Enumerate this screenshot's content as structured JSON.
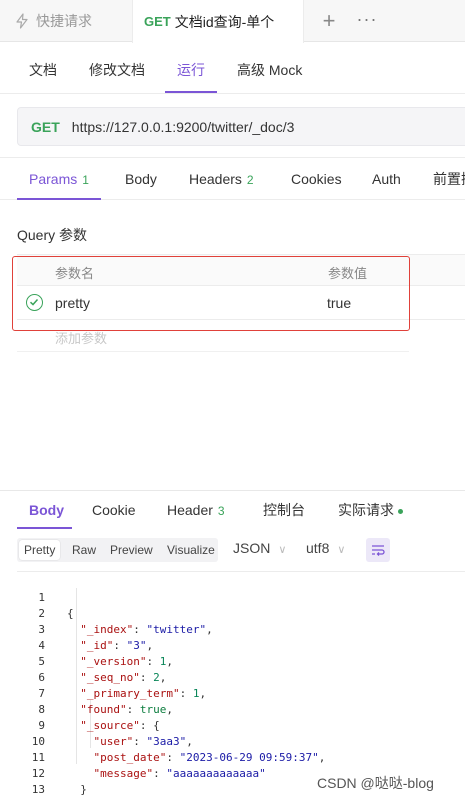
{
  "tabs": {
    "tab1_label": "快捷请求",
    "tab2_method": "GET",
    "tab2_label": "文档id查询-单个",
    "plus": "+",
    "more": "···"
  },
  "subnav": {
    "items": [
      "文档",
      "修改文档",
      "运行",
      "高级 Mock"
    ],
    "active": "运行"
  },
  "request": {
    "method": "GET",
    "url": "https://127.0.0.1:9200/twitter/_doc/3"
  },
  "req_tabs": {
    "params": "Params",
    "params_count": "1",
    "body": "Body",
    "headers": "Headers",
    "headers_count": "2",
    "cookies": "Cookies",
    "auth": "Auth",
    "more": "前置操"
  },
  "query": {
    "title": "Query 参数",
    "col_name": "参数名",
    "col_value": "参数值",
    "rows": [
      {
        "name": "pretty",
        "value": "true"
      }
    ],
    "add_placeholder": "添加参数"
  },
  "resp_tabs": {
    "body": "Body",
    "cookie": "Cookie",
    "header": "Header",
    "header_count": "3",
    "console": "控制台",
    "actual": "实际请求"
  },
  "format": {
    "modes": [
      "Pretty",
      "Raw",
      "Preview",
      "Visualize"
    ],
    "active": "Pretty",
    "type": "JSON",
    "encoding": "utf8"
  },
  "code_lines": [
    "1",
    "2",
    "3",
    "4",
    "5",
    "6",
    "7",
    "8",
    "9",
    "10",
    "11",
    "12",
    "13"
  ],
  "response": {
    "_index": "twitter",
    "_id": "3",
    "_version": "1",
    "_seq_no": "2",
    "_primary_term": "1",
    "found": "true",
    "user": "3aa3",
    "post_date": "2023-06-29 09:59:37",
    "message": "aaaaaaaaaaaaa"
  },
  "watermark": "CSDN @哒哒-blog",
  "colors": {
    "accent": "#7b55d6",
    "get": "#3aa35a",
    "highlight_box": "#e0413a"
  }
}
